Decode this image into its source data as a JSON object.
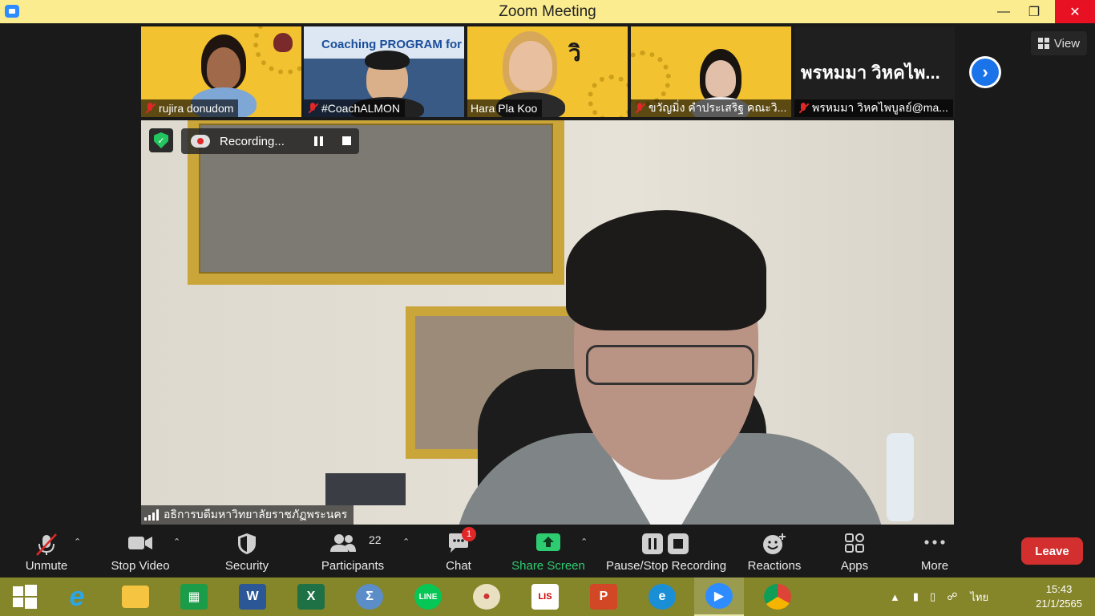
{
  "window": {
    "title": "Zoom Meeting"
  },
  "gallery": {
    "view_label": "View",
    "participants": [
      {
        "name": "rujira donudom",
        "muted": true,
        "bg": "#f2c230"
      },
      {
        "name": "#CoachALMON",
        "muted": true,
        "bg": "#3a5a86",
        "overlay": "Coaching PROGRAM for Lecturer"
      },
      {
        "name": "Hara Pla Koo",
        "muted": false,
        "bg": "#f2c230"
      },
      {
        "name": "ขวัญมิ่ง คำประเสริฐ คณะวิ...",
        "muted": true,
        "bg": "#f2c230"
      },
      {
        "name": "พรหมมา วิหคไพบูลย์@ma...",
        "muted": true,
        "bg": "#1f1f1f",
        "big_text": "พรหมมา วิหคไพ..."
      }
    ]
  },
  "main_video": {
    "speaker_name": "อธิการบดีมหาวิทยาลัยราชภัฏพระนคร",
    "recording_label": "Recording..."
  },
  "toolbar": {
    "unmute": "Unmute",
    "stop_video": "Stop Video",
    "security": "Security",
    "participants": "Participants",
    "participants_count": "22",
    "chat": "Chat",
    "chat_badge": "1",
    "share_screen": "Share Screen",
    "pause_stop_recording": "Pause/Stop Recording",
    "reactions": "Reactions",
    "apps": "Apps",
    "more": "More",
    "leave": "Leave"
  },
  "taskbar": {
    "apps": [
      {
        "name": "start-button"
      },
      {
        "name": "internet-explorer-icon"
      },
      {
        "name": "file-explorer-icon"
      },
      {
        "name": "store-icon"
      },
      {
        "name": "word-icon"
      },
      {
        "name": "excel-icon"
      },
      {
        "name": "math-input-icon"
      },
      {
        "name": "line-icon"
      },
      {
        "name": "paint-icon"
      },
      {
        "name": "lisrel-icon"
      },
      {
        "name": "powerpoint-icon"
      },
      {
        "name": "edge-icon"
      },
      {
        "name": "zoom-icon"
      },
      {
        "name": "chrome-icon"
      }
    ],
    "language": "ไทย",
    "time": "15:43",
    "date": "21/1/2565"
  },
  "colors": {
    "titlebar": "#fbec8f",
    "taskbar": "#85852a",
    "leave": "#d32f2f",
    "share": "#2ecc71",
    "accent_blue": "#1a73e8"
  }
}
